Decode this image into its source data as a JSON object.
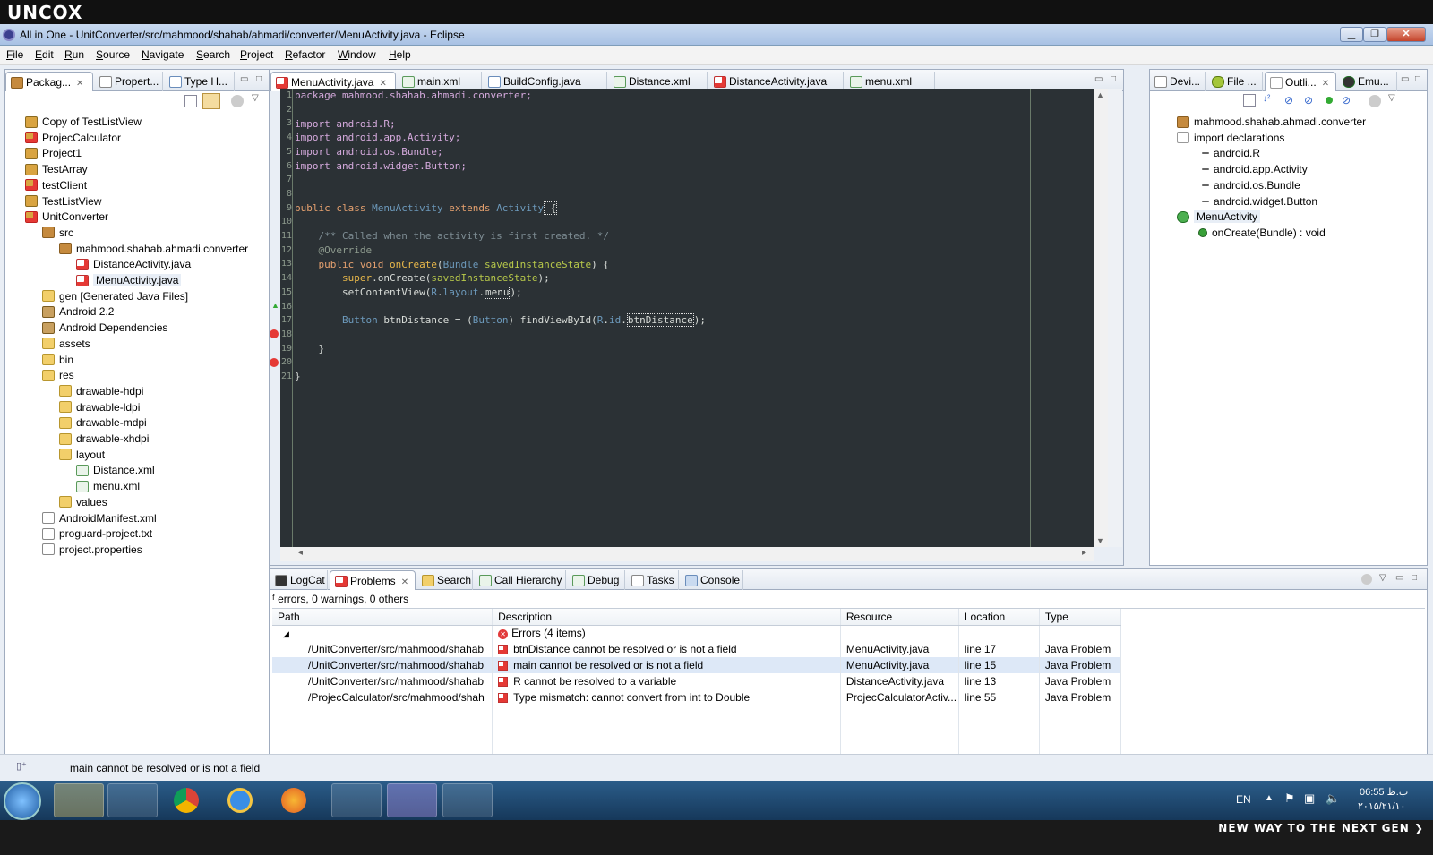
{
  "brand": {
    "logo": "UNCOX",
    "slogan": "NEW WAY TO THE NEXT GEN ❯"
  },
  "window": {
    "title": "All in One - UnitConverter/src/mahmood/shahab/ahmadi/converter/MenuActivity.java - Eclipse",
    "min": "▁",
    "max": "❐",
    "close": "✕"
  },
  "menubar": [
    "File",
    "Edit",
    "Run",
    "Source",
    "Navigate",
    "Search",
    "Project",
    "Refactor",
    "Window",
    "Help"
  ],
  "left_tabs": [
    {
      "label": "Packag...",
      "icon": "package-explorer-icon"
    },
    {
      "label": "Propert...",
      "icon": "properties-icon"
    },
    {
      "label": "Type H...",
      "icon": "type-hierarchy-icon"
    }
  ],
  "package_tree": [
    {
      "label": "Copy of TestListView",
      "icon": "proj",
      "indent": 0
    },
    {
      "label": "ProjecCalculator",
      "icon": "proj-err",
      "indent": 0
    },
    {
      "label": "Project1",
      "icon": "proj",
      "indent": 0
    },
    {
      "label": "TestArray",
      "icon": "proj",
      "indent": 0
    },
    {
      "label": "testClient",
      "icon": "proj-err",
      "indent": 0
    },
    {
      "label": "TestListView",
      "icon": "proj",
      "indent": 0
    },
    {
      "label": "UnitConverter",
      "icon": "proj-err",
      "indent": 0
    },
    {
      "label": "src",
      "icon": "pkg",
      "indent": 1
    },
    {
      "label": "mahmood.shahab.ahmadi.converter",
      "icon": "pkg",
      "indent": 2
    },
    {
      "label": "DistanceActivity.java",
      "icon": "java-err",
      "indent": 3
    },
    {
      "label": "MenuActivity.java",
      "icon": "java-err",
      "indent": 3,
      "selected": true
    },
    {
      "label": "gen [Generated Java Files]",
      "icon": "folder",
      "indent": 1
    },
    {
      "label": "Android 2.2",
      "icon": "lib",
      "indent": 1
    },
    {
      "label": "Android Dependencies",
      "icon": "lib",
      "indent": 1
    },
    {
      "label": "assets",
      "icon": "folder",
      "indent": 1
    },
    {
      "label": "bin",
      "icon": "folder",
      "indent": 1
    },
    {
      "label": "res",
      "icon": "folder",
      "indent": 1
    },
    {
      "label": "drawable-hdpi",
      "icon": "folder",
      "indent": 2
    },
    {
      "label": "drawable-ldpi",
      "icon": "folder",
      "indent": 2
    },
    {
      "label": "drawable-mdpi",
      "icon": "folder",
      "indent": 2
    },
    {
      "label": "drawable-xhdpi",
      "icon": "folder",
      "indent": 2
    },
    {
      "label": "layout",
      "icon": "folder",
      "indent": 2
    },
    {
      "label": "Distance.xml",
      "icon": "xml",
      "indent": 3
    },
    {
      "label": "menu.xml",
      "icon": "xml",
      "indent": 3
    },
    {
      "label": "values",
      "icon": "folder",
      "indent": 2
    },
    {
      "label": "AndroidManifest.xml",
      "icon": "file",
      "indent": 1
    },
    {
      "label": "proguard-project.txt",
      "icon": "file",
      "indent": 1
    },
    {
      "label": "project.properties",
      "icon": "file",
      "indent": 1
    }
  ],
  "editor_tabs": [
    {
      "label": "MenuActivity.java",
      "icon": "java-file-icon",
      "active": true
    },
    {
      "label": "main.xml",
      "icon": "xml-file-icon"
    },
    {
      "label": "BuildConfig.java",
      "icon": "java-file-icon"
    },
    {
      "label": "Distance.xml",
      "icon": "xml-file-icon"
    },
    {
      "label": "DistanceActivity.java",
      "icon": "java-file-icon"
    },
    {
      "label": "menu.xml",
      "icon": "xml-file-icon"
    }
  ],
  "code_lines": [
    "1",
    "2",
    "3",
    "4",
    "5",
    "6",
    "7",
    "8",
    "9",
    "10",
    "11",
    "12",
    "13",
    "14",
    "15",
    "16",
    "17",
    "18",
    "19",
    "20",
    "21"
  ],
  "code": {
    "l1": "package mahmood.shahab.ahmadi.converter;",
    "l3": "import android.R;",
    "l4": "import android.app.Activity;",
    "l5": "import android.os.Bundle;",
    "l6": "import android.widget.Button;",
    "l9a": "public class ",
    "l9b": "MenuActivity",
    "l9c": " extends ",
    "l9d": "Activity",
    "l9e": " {",
    "l11": "    /** Called when the activity is first created. */",
    "l12": "    @Override",
    "l13a": "    public void ",
    "l13b": "onCreate",
    "l13c": "(",
    "l13d": "Bundle",
    "l13e": " savedInstanceState",
    "l13f": ") {",
    "l14a": "        super",
    "l14b": ".onCreate(",
    "l14c": "savedInstanceState",
    "l14d": ");",
    "l15a": "        setContentView(",
    "l15b": "R",
    "l15c": ".",
    "l15d": "layout",
    "l15e": ".",
    "l15f": "menu",
    "l15g": ");",
    "l17a": "        ",
    "l17b": "Button",
    "l17c": " btnDistance = (",
    "l17d": "Button",
    "l17e": ") findViewById(",
    "l17f": "R",
    "l17g": ".",
    "l17h": "id",
    "l17i": ".",
    "l17j": "btnDistance",
    "l17k": ");",
    "l19": "    }",
    "l21": "}"
  },
  "right_tabs": [
    {
      "label": "Devi...",
      "icon": "devices-icon"
    },
    {
      "label": "File ...",
      "icon": "file-explorer-icon"
    },
    {
      "label": "Outli...",
      "icon": "outline-icon",
      "active": true
    },
    {
      "label": "Emu...",
      "icon": "emulator-icon"
    }
  ],
  "outline": [
    {
      "label": "mahmood.shahab.ahmadi.converter",
      "icon": "pkg",
      "indent": 0
    },
    {
      "label": "import declarations",
      "icon": "import",
      "indent": 0
    },
    {
      "label": "android.R",
      "icon": "ref",
      "indent": 1
    },
    {
      "label": "android.app.Activity",
      "icon": "ref",
      "indent": 1
    },
    {
      "label": "android.os.Bundle",
      "icon": "ref",
      "indent": 1
    },
    {
      "label": "android.widget.Button",
      "icon": "ref",
      "indent": 1
    },
    {
      "label": "MenuActivity",
      "icon": "class",
      "indent": 0,
      "selected": true
    },
    {
      "label": "onCreate(Bundle) : void",
      "icon": "method",
      "indent": 1
    }
  ],
  "bottom_tabs": [
    {
      "label": "LogCat",
      "icon": "logcat-icon"
    },
    {
      "label": "Problems",
      "icon": "problems-icon",
      "active": true
    },
    {
      "label": "Search",
      "icon": "search-icon"
    },
    {
      "label": "Call Hierarchy",
      "icon": "call-hierarchy-icon"
    },
    {
      "label": "Debug",
      "icon": "debug-icon"
    },
    {
      "label": "Tasks",
      "icon": "tasks-icon"
    },
    {
      "label": "Console",
      "icon": "console-icon"
    }
  ],
  "problems": {
    "summary": "errors, 0 warnings, 0 others",
    "columns": [
      "Path",
      "Description",
      "Resource",
      "Location",
      "Type"
    ],
    "group": "Errors (4 items)",
    "rows": [
      {
        "path": "/UnitConverter/src/mahmood/shahab",
        "description": "btnDistance cannot be resolved or is not a field",
        "resource": "MenuActivity.java",
        "location": "line 17",
        "type": "Java Problem"
      },
      {
        "path": "/UnitConverter/src/mahmood/shahab",
        "description": "main cannot be resolved or is not a field",
        "resource": "MenuActivity.java",
        "location": "line 15",
        "type": "Java Problem",
        "selected": true
      },
      {
        "path": "/UnitConverter/src/mahmood/shahab",
        "description": "R cannot be resolved to a variable",
        "resource": "DistanceActivity.java",
        "location": "line 13",
        "type": "Java Problem"
      },
      {
        "path": "/ProjecCalculator/src/mahmood/shah",
        "description": "Type mismatch: cannot convert from int to Double",
        "resource": "ProjecCalculatorActiv...",
        "location": "line 55",
        "type": "Java Problem"
      }
    ]
  },
  "statusbar": {
    "message": "main cannot be resolved or is not a field"
  },
  "taskbar": {
    "lang": "EN",
    "time": "06:55 ب.ظ",
    "date": "۲۰۱۵/۲۱/۱۰"
  }
}
